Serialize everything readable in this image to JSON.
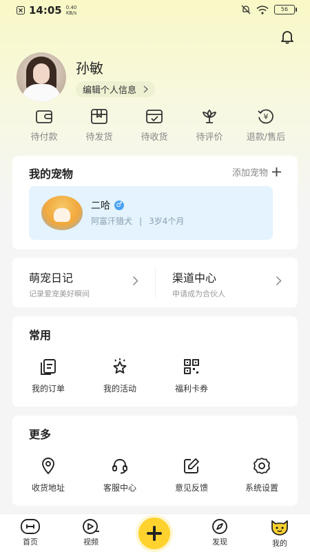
{
  "status_bar": {
    "time": "14:05",
    "speed_value": "0.40",
    "speed_unit": "KB/s",
    "battery": "56"
  },
  "profile": {
    "name": "孙敏",
    "edit_label": "编辑个人信息"
  },
  "orders": [
    {
      "label": "待付款",
      "icon": "wallet-icon"
    },
    {
      "label": "待发货",
      "icon": "package-icon"
    },
    {
      "label": "待收货",
      "icon": "delivery-icon"
    },
    {
      "label": "待评价",
      "icon": "flower-icon"
    },
    {
      "label": "退款/售后",
      "icon": "refund-icon"
    }
  ],
  "pets": {
    "title": "我的宠物",
    "add_label": "添加宠物",
    "pet": {
      "name": "二哈",
      "gender": "♂",
      "breed": "阿富汗猎犬",
      "separator": "|",
      "age": "3岁4个月"
    }
  },
  "services": [
    {
      "title": "萌宠日记",
      "subtitle": "记录爱宠美好瞬间"
    },
    {
      "title": "渠道中心",
      "subtitle": "申请成为合伙人"
    }
  ],
  "common": {
    "title": "常用",
    "items": [
      {
        "label": "我的订单",
        "icon": "order-list-icon"
      },
      {
        "label": "我的活动",
        "icon": "star-activity-icon"
      },
      {
        "label": "福利卡券",
        "icon": "qr-coupon-icon"
      }
    ]
  },
  "more": {
    "title": "更多",
    "items": [
      {
        "label": "收货地址",
        "icon": "location-icon"
      },
      {
        "label": "客服中心",
        "icon": "headset-icon"
      },
      {
        "label": "意见反馈",
        "icon": "edit-icon"
      },
      {
        "label": "系统设置",
        "icon": "gear-icon"
      }
    ]
  },
  "tabbar": [
    {
      "label": "首页",
      "icon": "home-icon"
    },
    {
      "label": "视频",
      "icon": "video-icon"
    },
    {
      "label": "发现",
      "icon": "compass-icon"
    },
    {
      "label": "我的",
      "icon": "mine-face-icon"
    }
  ],
  "colors": {
    "accent": "#ffd22e",
    "pet_card_bg": "#e4f3fd",
    "gender_badge": "#4aa3f0"
  }
}
